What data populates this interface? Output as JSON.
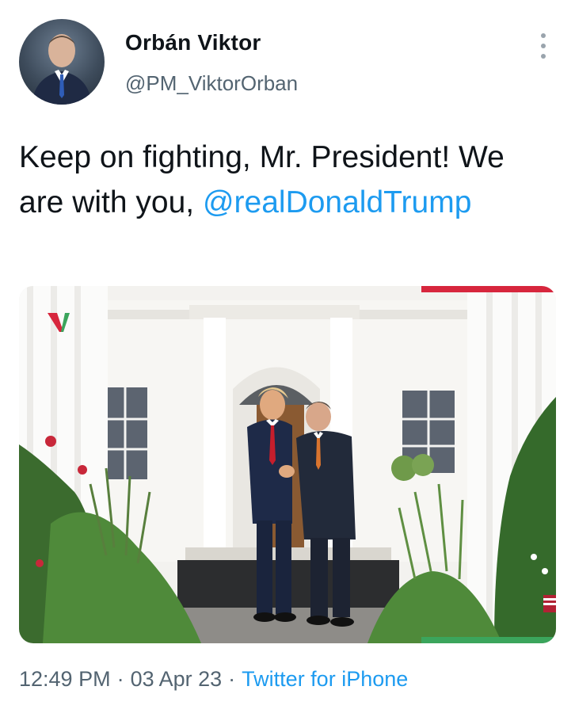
{
  "author": {
    "display_name": "Orbán Viktor",
    "handle": "@PM_ViktorOrban",
    "avatar": "profile-photo"
  },
  "tweet": {
    "text_parts": [
      "Keep on fighting, Mr. President! We are with you, "
    ],
    "mention": "@realDonaldTrump"
  },
  "media": {
    "type": "photo",
    "logo": "V"
  },
  "meta": {
    "time": "12:49 PM",
    "date": "03 Apr 23",
    "source": "Twitter for iPhone",
    "separator": "·"
  },
  "colors": {
    "link": "#1d9bf0",
    "secondary_text": "#536471",
    "hungarian_red": "#d7263d",
    "hungarian_green": "#3ba55c"
  },
  "icons": [
    "more-options-icon"
  ]
}
